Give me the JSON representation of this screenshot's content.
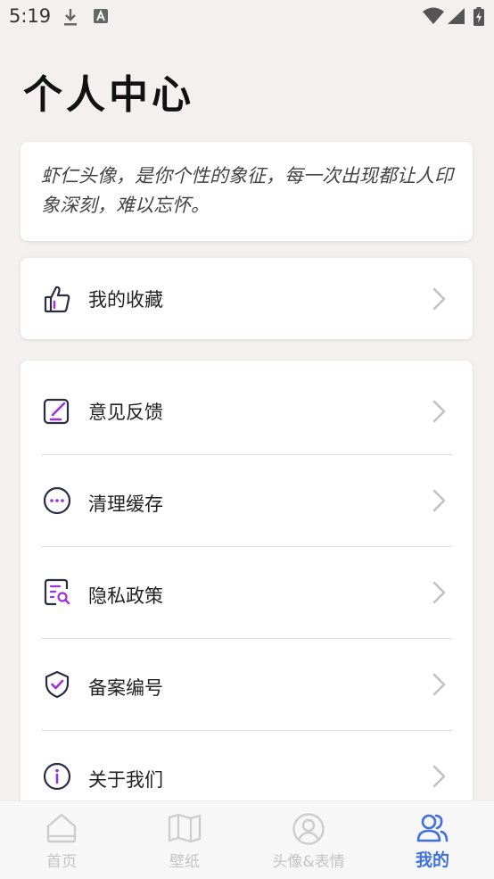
{
  "status_bar": {
    "time": "5:19"
  },
  "page": {
    "title": "个人中心"
  },
  "slogan": {
    "text": "虾仁头像，是你个性的象征，每一次出现都让人印象深刻，难以忘怀。"
  },
  "favorites": {
    "label": "我的收藏",
    "icon": "thumbs-up-icon"
  },
  "menu": {
    "items": [
      {
        "label": "意见反馈",
        "icon": "edit-icon"
      },
      {
        "label": "清理缓存",
        "icon": "more-dots-icon"
      },
      {
        "label": "隐私政策",
        "icon": "document-search-icon"
      },
      {
        "label": "备案编号",
        "icon": "shield-check-icon"
      },
      {
        "label": "关于我们",
        "icon": "info-icon"
      }
    ]
  },
  "tabbar": {
    "tabs": [
      {
        "label": "首页",
        "icon": "home-icon"
      },
      {
        "label": "壁纸",
        "icon": "map-icon"
      },
      {
        "label": "头像&表情",
        "icon": "user-circle-icon"
      },
      {
        "label": "我的",
        "icon": "people-icon",
        "active": true
      }
    ]
  },
  "colors": {
    "accent": "#3f6fe0",
    "icon_purple": "#9b30e0",
    "icon_dark": "#2a2e40"
  }
}
